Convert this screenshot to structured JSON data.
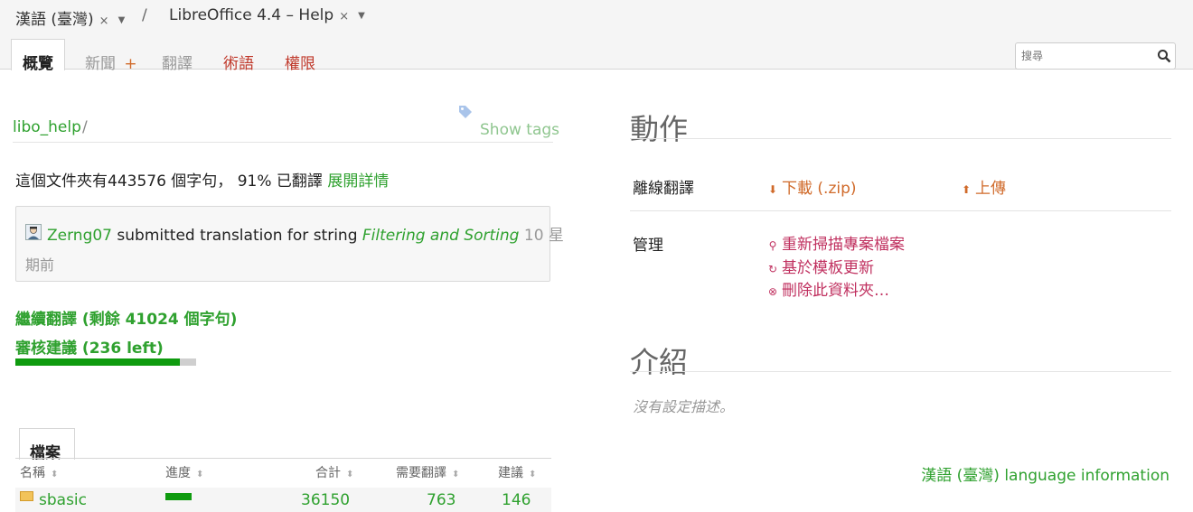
{
  "breadcrumb": {
    "language": "漢語 (臺灣)",
    "separator": "/",
    "project": "LibreOffice 4.4 – Help",
    "close_glyph": "×",
    "caret_glyph": "▼"
  },
  "tabs": {
    "overview": "概覽",
    "news": "新聞",
    "news_plus": "+",
    "translate": "翻譯",
    "terms": "術語",
    "permissions": "權限"
  },
  "search": {
    "placeholder": "搜尋"
  },
  "path": {
    "folder": "libo_help",
    "separator": "/"
  },
  "show_tags": "Show tags",
  "stats": {
    "prefix": "這個文件夾有443576 個字句，",
    "percent": "91% 已翻譯",
    "expand": "展開詳情"
  },
  "activity": {
    "user": "Zerng07",
    "text": "submitted translation for string",
    "string": "Filtering and Sorting",
    "time_a": "10 星",
    "time_b": "期前"
  },
  "continue_translation": "繼續翻譯 (剩餘 41024 個字句)",
  "review_suggestions": "審核建議 (236 left)",
  "progress": {
    "translated_percent": 91
  },
  "files": {
    "tab_label": "檔案",
    "columns": [
      "名稱",
      "進度",
      "合計",
      "需要翻譯",
      "建議"
    ],
    "sort_glyph": "⬍",
    "rows": [
      {
        "name": "sbasic",
        "progress_percent": 98,
        "total": "36150",
        "need_translation": "763",
        "suggestions": "146"
      }
    ]
  },
  "actions": {
    "title": "動作",
    "offline_label": "離線翻譯",
    "download": "下載 (.zip)",
    "upload": "上傳",
    "manage_label": "管理",
    "rescan": "重新掃描專案檔案",
    "update_template": "基於模板更新",
    "delete_folder": "刪除此資料夾…"
  },
  "intro": {
    "title": "介紹",
    "no_description": "沒有設定描述。"
  },
  "language_info": "漢語 (臺灣) language information",
  "colors": {
    "green": "#2fa12f",
    "orange": "#d06a2a",
    "red": "#c0392b",
    "pink": "#c0305f",
    "progress": "#0f9b0f"
  }
}
